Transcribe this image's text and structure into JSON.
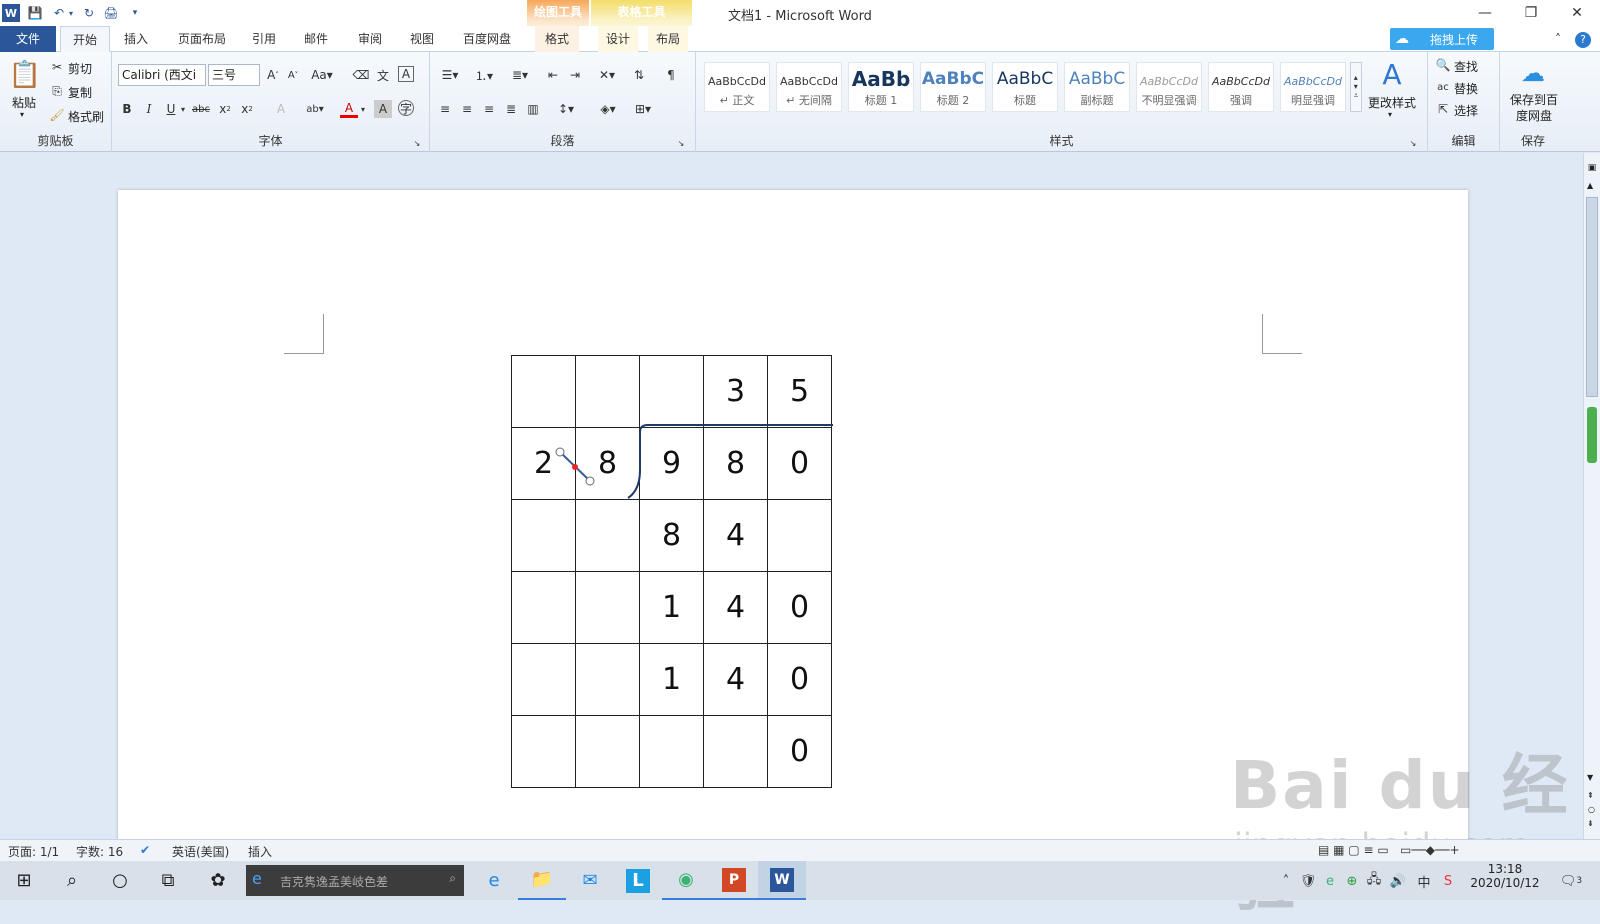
{
  "window": {
    "title": "文档1 - Microsoft Word",
    "ctx_drawing": "绘图工具",
    "ctx_table": "表格工具",
    "minimize": "—",
    "restore": "❐",
    "close": "✕"
  },
  "tabs": {
    "file": "文件",
    "home": "开始",
    "insert": "插入",
    "layout": "页面布局",
    "references": "引用",
    "mailings": "邮件",
    "review": "审阅",
    "view": "视图",
    "baidu": "百度网盘",
    "format": "格式",
    "design": "设计",
    "table_layout": "布局",
    "upload": "拖拽上传"
  },
  "ribbon": {
    "clipboard": {
      "paste": "粘贴",
      "cut": "剪切",
      "copy": "复制",
      "format_painter": "格式刷",
      "label": "剪贴板"
    },
    "font": {
      "font_name": "Calibri (西文i",
      "font_size": "三号",
      "label": "字体"
    },
    "paragraph": {
      "label": "段落"
    },
    "styles": {
      "label": "样式",
      "change": "更改样式",
      "items": [
        {
          "preview": "AaBbCcDd",
          "name": "↵ 正文"
        },
        {
          "preview": "AaBbCcDd",
          "name": "↵ 无间隔"
        },
        {
          "preview": "AaBb",
          "name": "标题 1"
        },
        {
          "preview": "AaBbC",
          "name": "标题 2"
        },
        {
          "preview": "AaBbC",
          "name": "标题"
        },
        {
          "preview": "AaBbC",
          "name": "副标题"
        },
        {
          "preview": "AaBbCcDd",
          "name": "不明显强调"
        },
        {
          "preview": "AaBbCcDd",
          "name": "强调"
        },
        {
          "preview": "AaBbCcDd",
          "name": "明显强调"
        }
      ]
    },
    "editing": {
      "find": "查找",
      "replace": "替换",
      "select": "选择",
      "label": "编辑"
    },
    "save": {
      "save_baidu": "保存到百度网盘",
      "label": "保存"
    }
  },
  "table": {
    "rows": [
      [
        "",
        "",
        "",
        "3",
        "5"
      ],
      [
        "2",
        "8",
        "9",
        "8",
        "0"
      ],
      [
        "",
        "",
        "8",
        "4",
        ""
      ],
      [
        "",
        "",
        "1",
        "4",
        "0"
      ],
      [
        "",
        "",
        "1",
        "4",
        "0"
      ],
      [
        "",
        "",
        "",
        "",
        "0"
      ]
    ]
  },
  "status": {
    "page": "页面: 1/1",
    "words": "字数: 16",
    "language": "英语(美国)",
    "mode": "插入"
  },
  "taskbar": {
    "search_placeholder": "吉克隽逸孟美岐色差",
    "time": "13:18",
    "date": "2020/10/12",
    "ime": "中",
    "notifications": "3"
  },
  "watermark": {
    "line1": "Bai du 经验",
    "line2": "jingyan.baidu.com"
  }
}
